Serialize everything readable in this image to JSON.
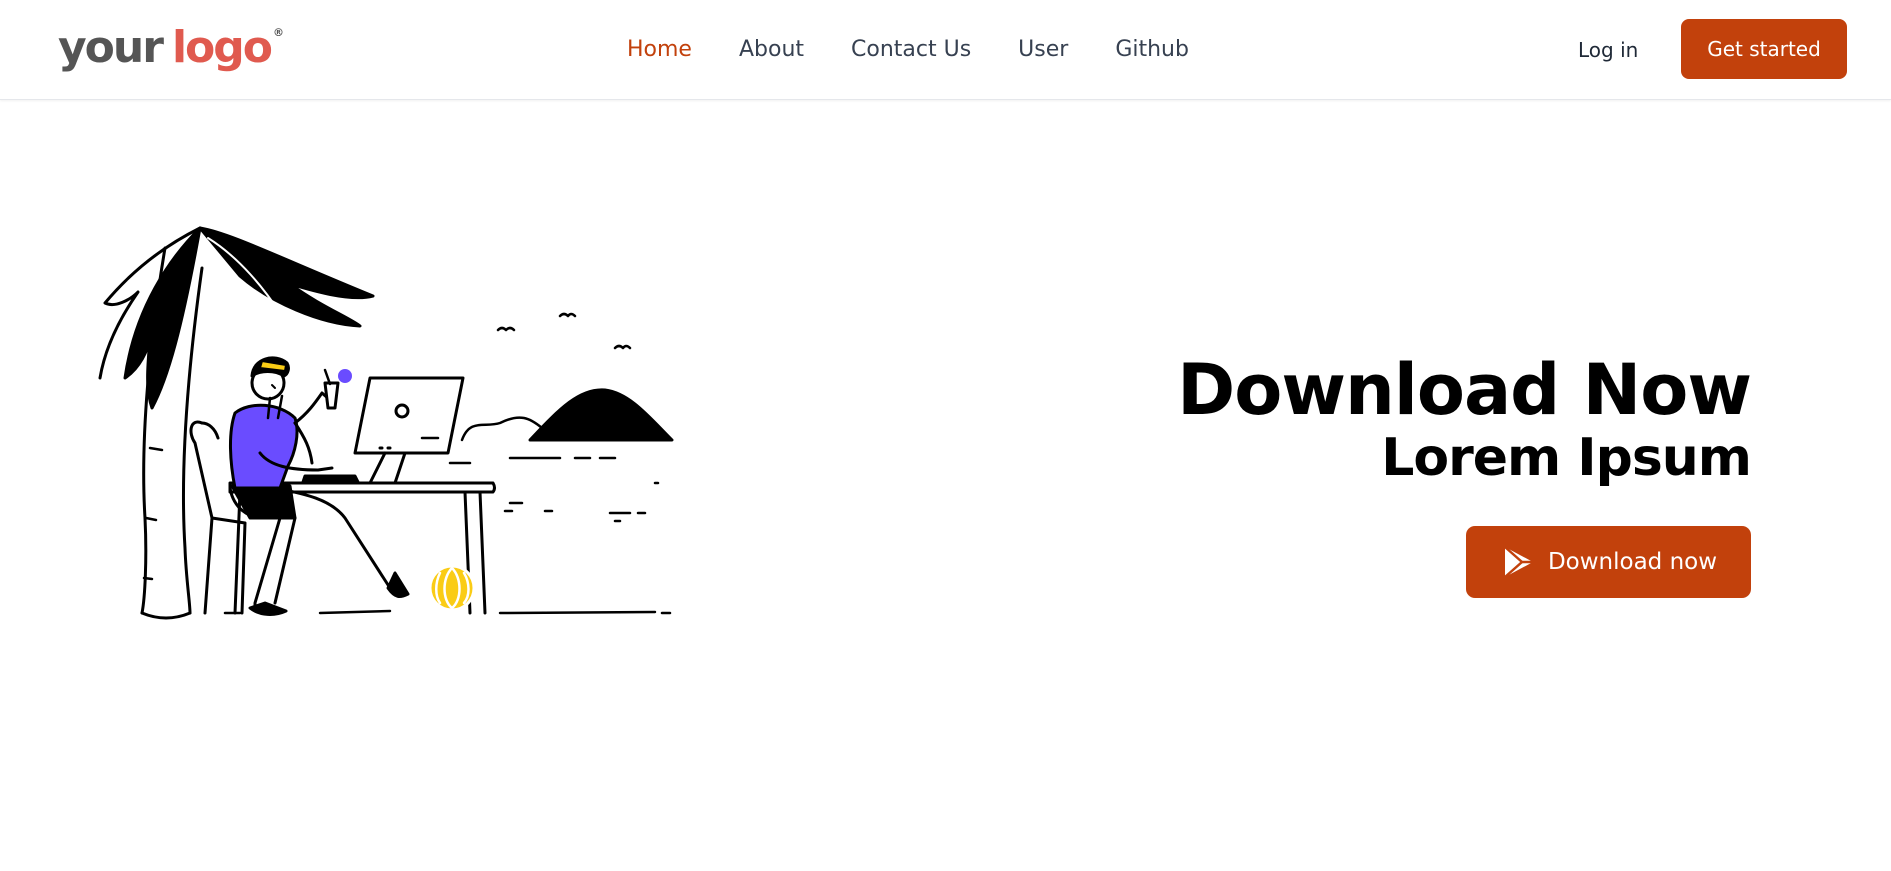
{
  "header": {
    "logo": {
      "word1": "your",
      "word2": "logo",
      "mark": "®"
    },
    "nav": [
      {
        "label": "Home",
        "active": true
      },
      {
        "label": "About",
        "active": false
      },
      {
        "label": "Contact Us",
        "active": false
      },
      {
        "label": "User",
        "active": false
      },
      {
        "label": "Github",
        "active": false
      }
    ],
    "login_label": "Log in",
    "cta_label": "Get started"
  },
  "hero": {
    "title": "Download Now",
    "subtitle": "Lorem Ipsum",
    "download_label": "Download now",
    "download_icon": "play-store-icon",
    "illustration": "man-working-at-laptop-under-palm-tree"
  },
  "colors": {
    "accent": "#c2410c",
    "logo_red": "#e05a4f",
    "logo_gray": "#555555",
    "nav_text": "#374151",
    "shirt": "#6a4cff",
    "ball": "#facc15"
  }
}
